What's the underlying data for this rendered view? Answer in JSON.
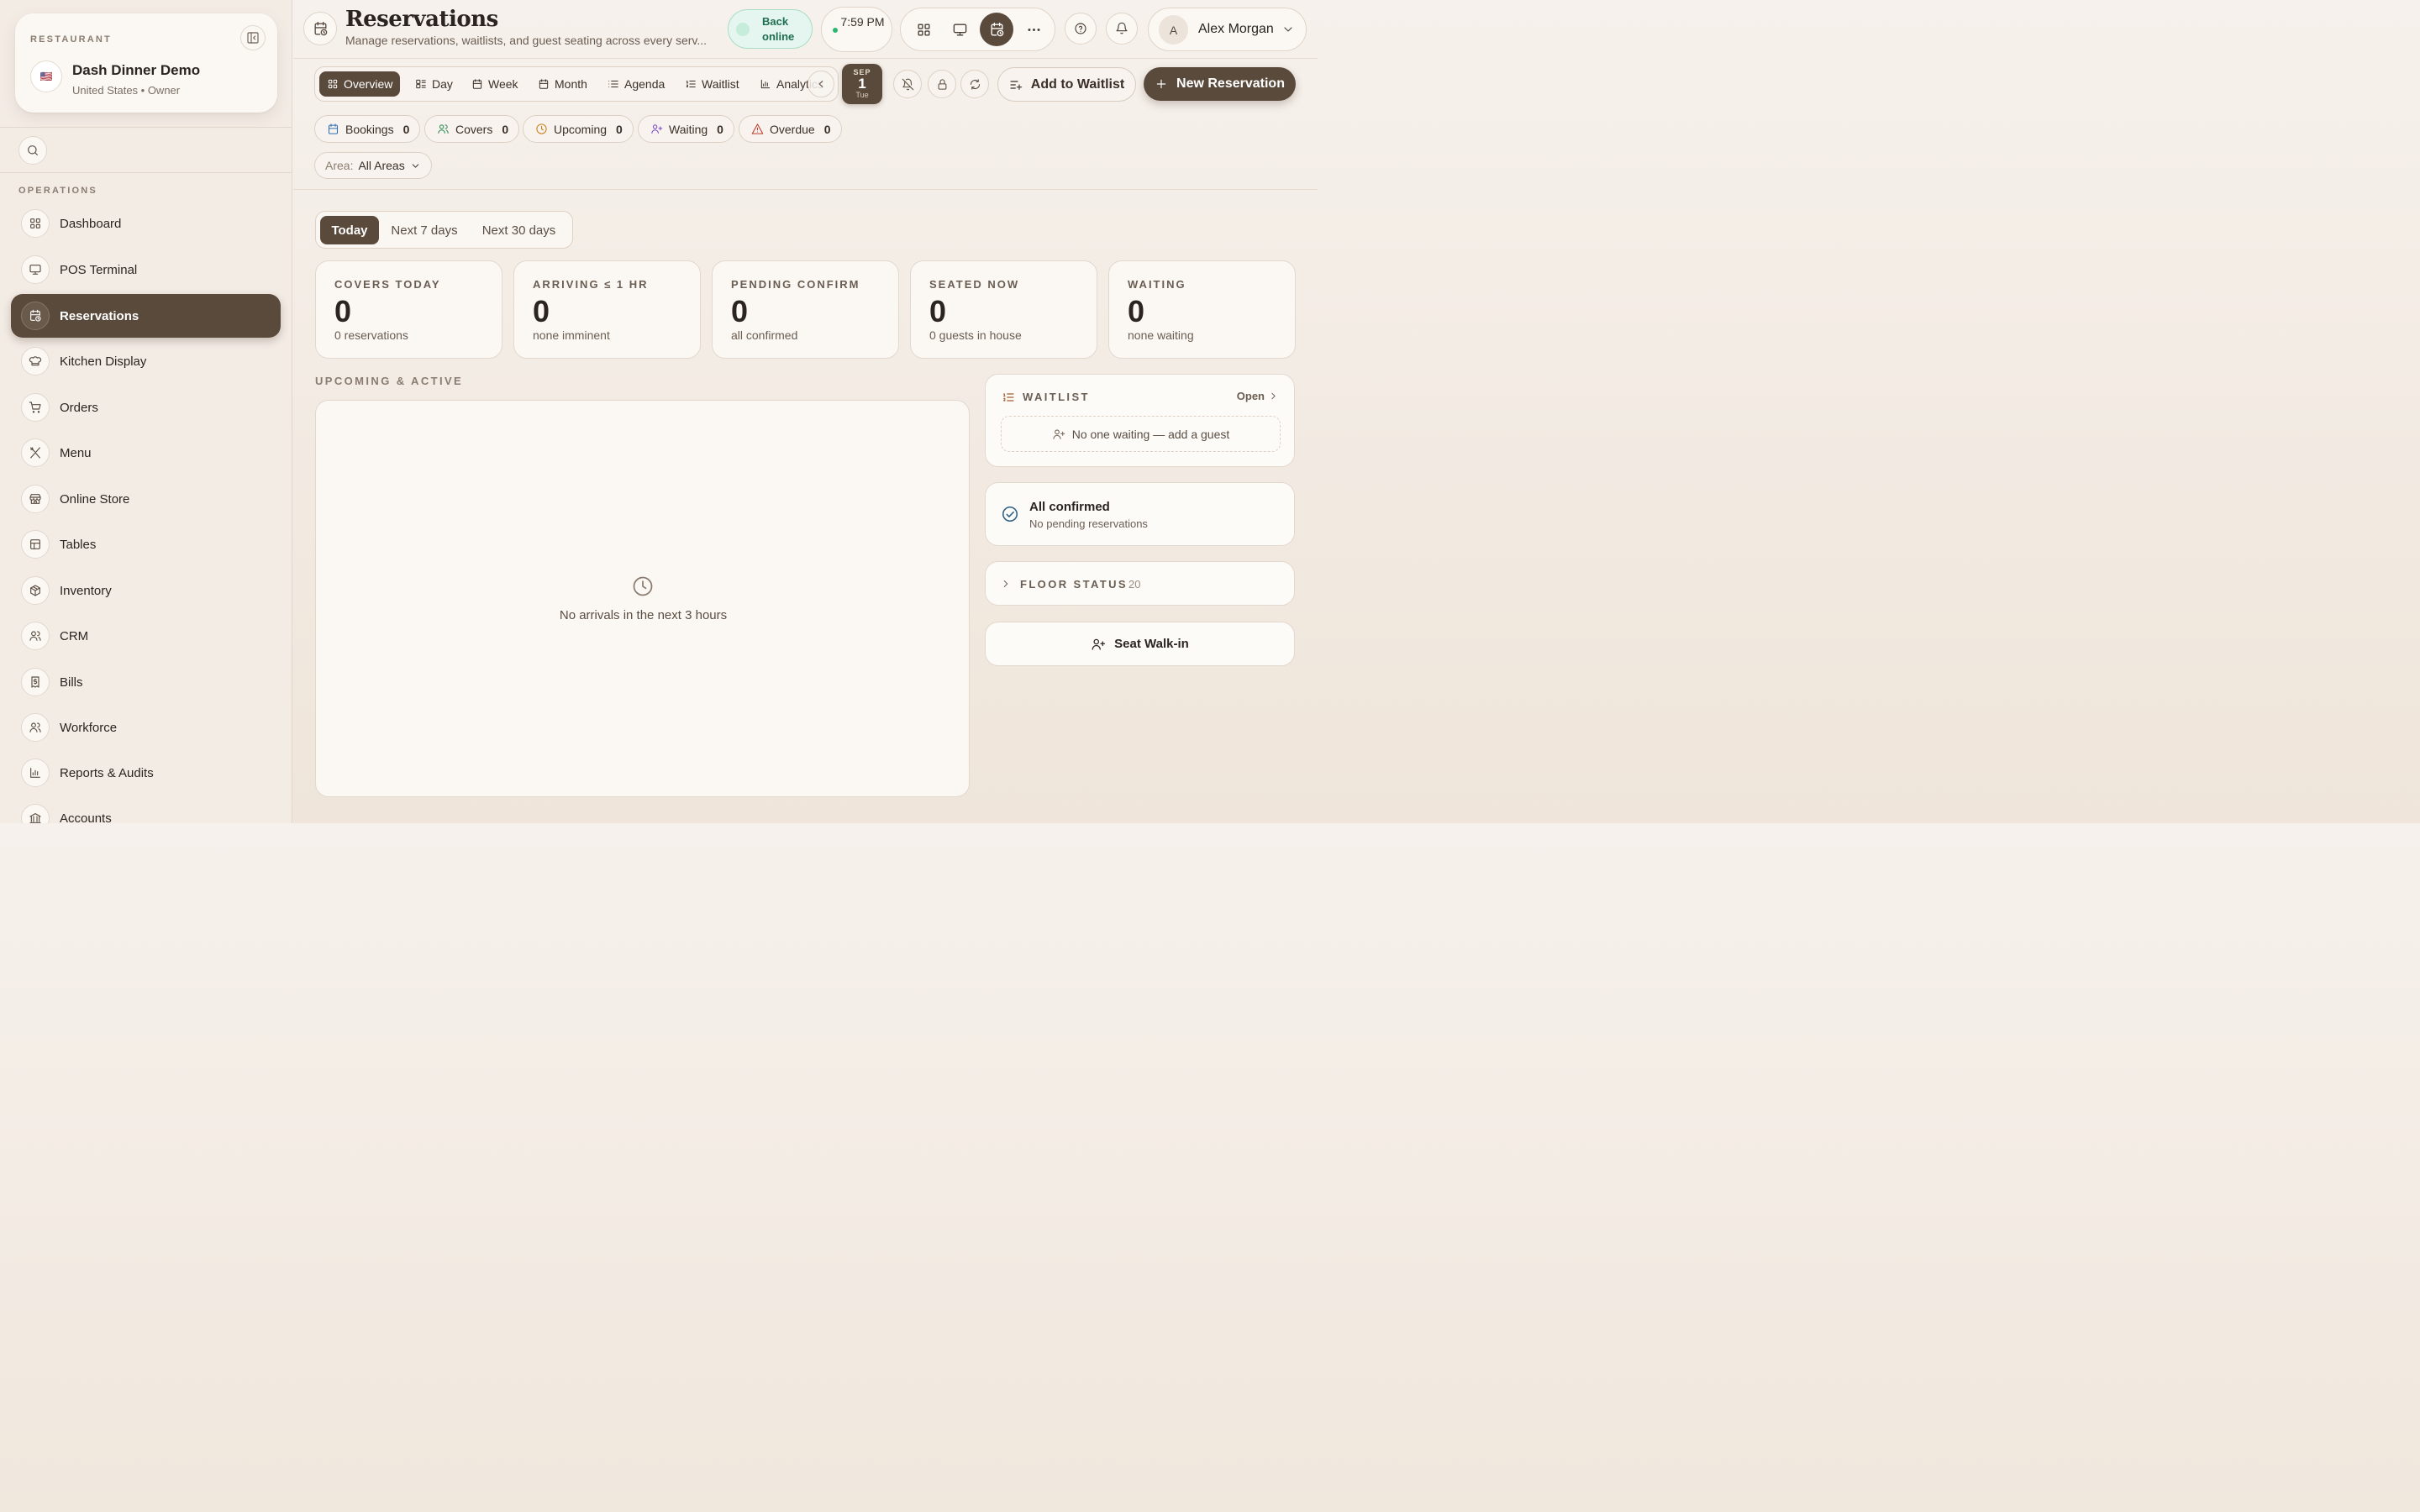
{
  "sidebar": {
    "restaurant_label": "RESTAURANT",
    "flag": "🇺🇸",
    "restaurant_name": "Dash Dinner Demo",
    "restaurant_sub": "United States • Owner",
    "section_label": "OPERATIONS",
    "items": [
      {
        "label": "Dashboard",
        "icon": "grid-icon"
      },
      {
        "label": "POS Terminal",
        "icon": "monitor-icon"
      },
      {
        "label": "Reservations",
        "icon": "calendar-clock-icon",
        "active": true
      },
      {
        "label": "Kitchen Display",
        "icon": "chef-hat-icon"
      },
      {
        "label": "Orders",
        "icon": "cart-icon"
      },
      {
        "label": "Menu",
        "icon": "utensils-icon"
      },
      {
        "label": "Online Store",
        "icon": "store-icon"
      },
      {
        "label": "Tables",
        "icon": "table-icon"
      },
      {
        "label": "Inventory",
        "icon": "package-icon"
      },
      {
        "label": "CRM",
        "icon": "users-icon"
      },
      {
        "label": "Bills",
        "icon": "receipt-icon"
      },
      {
        "label": "Workforce",
        "icon": "users-icon"
      },
      {
        "label": "Reports & Audits",
        "icon": "bar-chart-icon"
      },
      {
        "label": "Accounts",
        "icon": "bank-icon"
      }
    ]
  },
  "header": {
    "title": "Reservations",
    "subtitle": "Manage reservations, waitlists, and guest seating across every serv...",
    "status": "Back online",
    "time": "7:59 PM",
    "user_initial": "A",
    "user_name": "Alex Morgan"
  },
  "view_tabs": [
    {
      "label": "Overview",
      "icon": "grid-icon",
      "active": true
    },
    {
      "label": "Day",
      "icon": "layout-list-icon"
    },
    {
      "label": "Week",
      "icon": "calendar-icon"
    },
    {
      "label": "Month",
      "icon": "calendar-icon"
    },
    {
      "label": "Agenda",
      "icon": "list-icon"
    },
    {
      "label": "Waitlist",
      "icon": "list-ordered-icon"
    },
    {
      "label": "Analytics",
      "icon": "bar-chart-icon"
    }
  ],
  "date_badge": {
    "month": "SEP",
    "day": "1",
    "weekday": "Tue"
  },
  "actions": {
    "add_waitlist": "Add to Waitlist",
    "new_reservation": "New Reservation"
  },
  "chips": [
    {
      "label": "Bookings",
      "count": "0",
      "icon": "calendar-icon",
      "color": "#2f6fb3"
    },
    {
      "label": "Covers",
      "count": "0",
      "icon": "users-icon",
      "color": "#2e8b57"
    },
    {
      "label": "Upcoming",
      "count": "0",
      "icon": "clock-icon",
      "color": "#c9801a"
    },
    {
      "label": "Waiting",
      "count": "0",
      "icon": "user-plus-icon",
      "color": "#7a4bc4"
    },
    {
      "label": "Overdue",
      "count": "0",
      "icon": "alert-triangle-icon",
      "color": "#c0392b"
    }
  ],
  "area_filter": {
    "label": "Area:",
    "value": "All Areas"
  },
  "range_tabs": [
    {
      "label": "Today",
      "active": true
    },
    {
      "label": "Next 7 days"
    },
    {
      "label": "Next 30 days"
    }
  ],
  "stats": [
    {
      "label": "COVERS TODAY",
      "value": "0",
      "sub": "0 reservations"
    },
    {
      "label": "ARRIVING ≤ 1 HR",
      "value": "0",
      "sub": "none imminent"
    },
    {
      "label": "PENDING CONFIRM",
      "value": "0",
      "sub": "all confirmed"
    },
    {
      "label": "SEATED NOW",
      "value": "0",
      "sub": "0 guests in house"
    },
    {
      "label": "WAITING",
      "value": "0",
      "sub": "none waiting"
    }
  ],
  "upcoming": {
    "title": "UPCOMING & ACTIVE",
    "empty": "No arrivals in the next 3 hours"
  },
  "waitlist": {
    "title": "WAITLIST",
    "open": "Open",
    "empty": "No one waiting — add a guest"
  },
  "confirmed": {
    "title": "All confirmed",
    "sub": "No pending reservations"
  },
  "floor": {
    "title": "FLOOR STATUS",
    "count": "20"
  },
  "walkin": {
    "label": "Seat Walk-in"
  },
  "colors": {
    "accent": "#5a4a3c",
    "online_bg": "#e4f6ef",
    "online_text": "#1f6e52",
    "confirm_icon": "#2c5f86"
  }
}
